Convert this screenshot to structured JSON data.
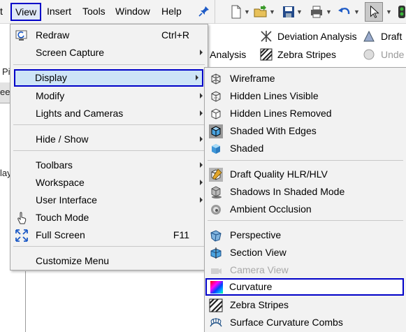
{
  "menubar": {
    "items": [
      "t",
      "View",
      "Insert",
      "Tools",
      "Window",
      "Help"
    ]
  },
  "commands": {
    "deviation_analysis": "Deviation Analysis",
    "draft": "Draft",
    "analysis_fragment": "y Analysis",
    "zebra_stripes": "Zebra Stripes",
    "undercut_fragment": "Unde"
  },
  "left_fragments": {
    "p": "Pi",
    "ee": "ee",
    "lay": "lay"
  },
  "view_menu": {
    "items": [
      {
        "label": "Redraw",
        "shortcut": "Ctrl+R",
        "icon": "redraw-icon"
      },
      {
        "label": "Screen Capture",
        "submenu": true
      },
      {
        "label": "Display",
        "submenu": true,
        "highlighted": true
      },
      {
        "label": "Modify",
        "submenu": true
      },
      {
        "label": "Lights and Cameras",
        "submenu": true
      },
      {
        "label": "Hide / Show",
        "submenu": true
      },
      {
        "label": "Toolbars",
        "submenu": true
      },
      {
        "label": "Workspace",
        "submenu": true
      },
      {
        "label": "User Interface",
        "submenu": true
      },
      {
        "label": "Touch Mode",
        "icon": "touch-icon"
      },
      {
        "label": "Full Screen",
        "shortcut": "F11",
        "icon": "fullscreen-icon"
      },
      {
        "label": "Customize Menu"
      }
    ]
  },
  "display_menu": {
    "items": [
      {
        "label": "Wireframe",
        "icon": "wireframe-icon"
      },
      {
        "label": "Hidden Lines Visible",
        "icon": "hidden-lines-visible-icon"
      },
      {
        "label": "Hidden Lines Removed",
        "icon": "hidden-lines-removed-icon"
      },
      {
        "label": "Shaded With Edges",
        "icon": "shaded-with-edges-icon"
      },
      {
        "label": "Shaded",
        "icon": "shaded-icon"
      },
      {
        "label": "Draft Quality HLR/HLV",
        "icon": "draft-quality-icon"
      },
      {
        "label": "Shadows In Shaded Mode",
        "icon": "shadows-icon"
      },
      {
        "label": "Ambient Occlusion",
        "icon": "ambient-occlusion-icon"
      },
      {
        "label": "Perspective",
        "icon": "perspective-icon"
      },
      {
        "label": "Section View",
        "icon": "section-view-icon"
      },
      {
        "label": "Camera View",
        "icon": "camera-view-icon",
        "disabled": true
      },
      {
        "label": "Curvature",
        "icon": "curvature-icon",
        "highlighted": true
      },
      {
        "label": "Zebra Stripes",
        "icon": "zebra-stripes-icon"
      },
      {
        "label": "Surface Curvature Combs",
        "icon": "curvature-combs-icon"
      }
    ]
  },
  "colors": {
    "highlight_border": "#0000c8",
    "highlight_fill": "#cde4f7",
    "menu_bg": "#f2f2f2"
  }
}
